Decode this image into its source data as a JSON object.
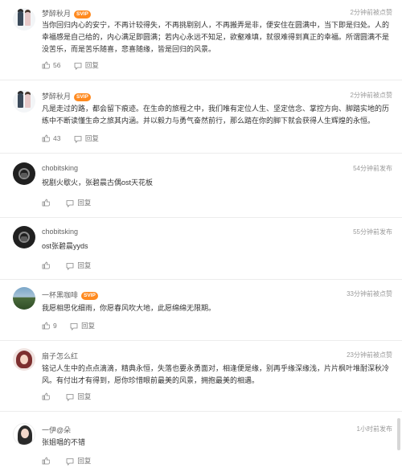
{
  "comments": [
    {
      "user": "梦醉秋月",
      "vip": "SVIP",
      "meta": "2分钟前被点赞",
      "text": "当你回归内心的安宁，不再计较得失，不再挑剔别人，不再搬弄是非，便安住在圆满中，当下即是归处。人的幸福感是自己给的，内心满足即圆满；若内心永远不知足，欲壑难填，就很难得到真正的幸福。所谓圆满不是没苦乐，而是苦乐随喜，悲喜随缘，皆是回归的风景。",
      "likes": "56",
      "reply": "回复",
      "avatar": "couple-avatar"
    },
    {
      "user": "梦醉秋月",
      "vip": "SVIP",
      "meta": "2分钟前被点赞",
      "text": "凡是走过的路，都会留下痕迹。在生命的旅程之中，我们唯有定位人生、坚定信念、掌控方向、脚踏实地的历练中不断读懂生命之旅其内涵。并以毅力与勇气奋然前行，那么踏在你的脚下就会获得人生辉煌的永恒。",
      "likes": "43",
      "reply": "回复",
      "avatar": "couple-avatar"
    },
    {
      "user": "chobitsking",
      "vip": "",
      "meta": "54分钟前发布",
      "text": "祝剧火歇火，张碧晨古偶ost天花板",
      "likes": "",
      "reply": "回复",
      "avatar": "dark-avatar"
    },
    {
      "user": "chobitsking",
      "vip": "",
      "meta": "55分钟前发布",
      "text": "ost张碧晨yyds",
      "likes": "",
      "reply": "回复",
      "avatar": "dark-avatar"
    },
    {
      "user": "一杯黑咖啡",
      "vip": "SVIP",
      "meta": "33分钟前被点赞",
      "text": "我愿相思化细雨，你愿春风吹大地，此愿绵绵无限期。",
      "likes": "9",
      "reply": "回复",
      "avatar": "scenery-avatar"
    },
    {
      "user": "扇子怎么红",
      "vip": "",
      "meta": "23分钟前被点赞",
      "text": "铭记人生中的点点滴滴，精典永恒，失落也要永勇面对，相逢便是缘，别再乎缘深缘浅，片片枫叶堆耐深秋冷风。有付出才有得到，愿你珍惜眼前最美的风景，拥抱最美的相遇。",
      "likes": "",
      "reply": "回复",
      "avatar": "girl-avatar"
    },
    {
      "user": "一伊@朵",
      "vip": "",
      "meta": "1小时前发布",
      "text": "张姐唱的不错",
      "likes": "",
      "reply": "回复",
      "avatar": "woman-avatar"
    }
  ],
  "icons": {
    "like": "thumbs-up-icon",
    "reply": "speech-bubble-icon"
  },
  "colors": {
    "vip_badge": "#ff8a1f",
    "username": "#636363",
    "meta": "#9a9a9a"
  }
}
